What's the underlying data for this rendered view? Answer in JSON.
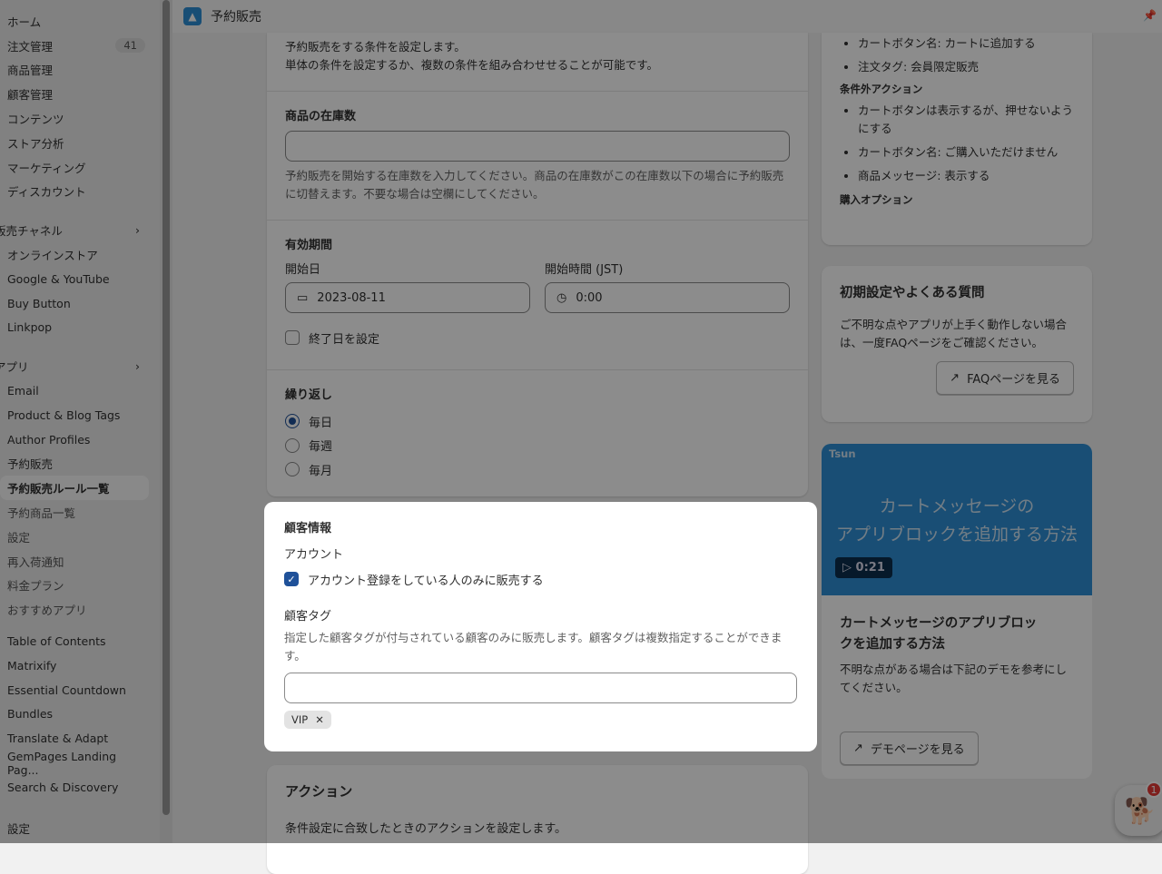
{
  "app": {
    "title": "予約販売"
  },
  "sidebar": {
    "main": [
      {
        "label": "ホーム"
      },
      {
        "label": "注文管理",
        "badge": "41"
      },
      {
        "label": "商品管理"
      },
      {
        "label": "顧客管理"
      },
      {
        "label": "コンテンツ"
      },
      {
        "label": "ストア分析"
      },
      {
        "label": "マーケティング"
      },
      {
        "label": "ディスカウント"
      }
    ],
    "channels_head": "販売チャネル",
    "channels": [
      {
        "label": "オンラインストア"
      },
      {
        "label": "Google & YouTube"
      },
      {
        "label": "Buy Button"
      },
      {
        "label": "Linkpop"
      }
    ],
    "apps_head": "アプリ",
    "apps": [
      {
        "label": "Email"
      },
      {
        "label": "Product & Blog Tags"
      },
      {
        "label": "Author Profiles"
      },
      {
        "label": "予約販売"
      }
    ],
    "app_sub": [
      {
        "label": "予約販売ルール一覧"
      },
      {
        "label": "予約商品一覧"
      },
      {
        "label": "設定"
      },
      {
        "label": "再入荷通知"
      },
      {
        "label": "料金プラン"
      },
      {
        "label": "おすすめアプリ"
      }
    ],
    "more_apps": [
      {
        "label": "Table of Contents"
      },
      {
        "label": "Matrixify"
      },
      {
        "label": "Essential Countdown"
      },
      {
        "label": "Bundles"
      },
      {
        "label": "Translate & Adapt"
      },
      {
        "label": "GemPages Landing Pag..."
      },
      {
        "label": "Search & Discovery"
      }
    ],
    "settings": "設定"
  },
  "conditions": {
    "intro1": "予約販売をする条件を設定します。",
    "intro2": "単体の条件を設定するか、複数の条件を組み合わせせることが可能です。",
    "stock": {
      "title": "商品の在庫数",
      "value": "",
      "help": "予約販売を開始する在庫数を入力してください。商品の在庫数がこの在庫数以下の場合に予約販売に切替えます。不要な場合は空欄にしてください。"
    },
    "period": {
      "title": "有効期間",
      "start_date_label": "開始日",
      "start_date": "2023-08-11",
      "start_time_label": "開始時間 (JST)",
      "start_time": "0:00",
      "end_label": "終了日を設定",
      "end_checked": false
    },
    "repeat": {
      "title": "繰り返し",
      "options": [
        "毎日",
        "毎週",
        "毎月"
      ],
      "selected": "毎日"
    }
  },
  "customer": {
    "title": "顧客情報",
    "account_label": "アカウント",
    "account_checkbox": "アカウント登録をしている人のみに販売する",
    "account_checked": true,
    "tag_label": "顧客タグ",
    "tag_help": "指定した顧客タグが付与されている顧客のみに販売します。顧客タグは複数指定することができます。",
    "tag_value": "",
    "tags": [
      "VIP"
    ]
  },
  "action": {
    "title": "アクション",
    "desc": "条件設定に合致したときのアクションを設定します。"
  },
  "summary": {
    "items1": [
      "カートボタン名: カートに追加する",
      "注文タグ: 会員限定販売"
    ],
    "out_head": "条件外アクション",
    "items2": [
      "カートボタンは表示するが、押せないようにする",
      "カートボタン名: ご購入いただけません",
      "商品メッセージ: 表示する"
    ],
    "purchase_head": "購入オプション"
  },
  "faq": {
    "title": "初期設定やよくある質問",
    "desc": "ご不明な点やアプリが上手く動作しない場合は、一度FAQページをご確認ください。",
    "button": "FAQページを見る"
  },
  "video": {
    "brand": "Tsun",
    "line1": "カートメッセージの",
    "line2": "アプリブロックを追加する方法",
    "duration": "0:21",
    "title": "カートメッセージのアプリブロックを追加する方法",
    "desc": "不明な点がある場合は下記のデモを参考にしてください。",
    "button": "デモページを見る"
  },
  "chat": {
    "badge": "1"
  },
  "colors": {
    "accent": "#1f5199",
    "video_bg": "#2e8fd6"
  }
}
